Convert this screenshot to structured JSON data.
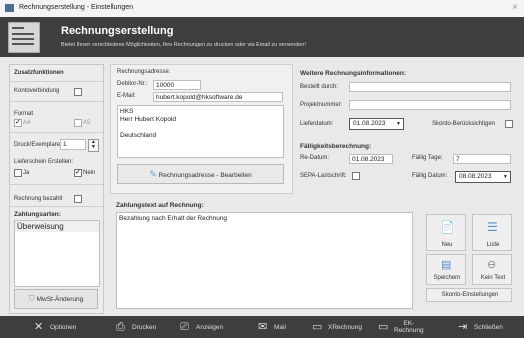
{
  "window": {
    "title": "Rechnungserstellung - Einstellungen",
    "close": "×"
  },
  "header": {
    "title": "Rechnungserstellung",
    "subtitle": "Bietet Ihnen verschiedene Möglichkeiten, Ihre Rechnungen zu drucken oder via Email zu versenden!"
  },
  "sidebar": {
    "zusatz_title": "Zusatzfunktionen",
    "kontoverbindung": "Kontoverbindung",
    "format_label": "Format",
    "format_a4": "A4",
    "format_a5": "A5",
    "druck_label": "Druck/Exemplare",
    "druck_value": "1",
    "lieferschein_label": "Lieferschein Erstellen:",
    "ja": "Ja",
    "nein": "Nein",
    "rechnung_bezahlt": "Rechnung bezahlt",
    "zahlungsarten_title": "Zahlungsarten:",
    "zahlungsart_item": "Überweisung",
    "mwst_button": "MwSt-Änderung"
  },
  "address": {
    "title": "Rechnungsadresse:",
    "debitor_label": "Debitor-Nr.:",
    "debitor_value": "10000",
    "email_label": "E-Mail:",
    "email_value": "hubert.kopold@hksoftware.de",
    "lines": [
      "HKS",
      "Herr Hubert Kopold",
      "",
      "Deutschland"
    ],
    "edit_button": "Rechnungsadresse - Bearbeiten"
  },
  "info": {
    "title": "Weitere Rechnungsinformationen:",
    "bestellt_label": "Bestellt durch:",
    "bestellt_value": "",
    "projekt_label": "Projektnummer:",
    "projekt_value": "",
    "lieferdatum_label": "Lieferdatum:",
    "lieferdatum_value": "01.08.2023",
    "skonto_label": "Skonto-Berücksichtigen"
  },
  "faellig": {
    "title": "Fälligkeitsberechnung:",
    "redatum_label": "Re-Datum:",
    "redatum_value": "01.08.2023",
    "tage_label": "Fällig Tage:",
    "tage_value": "7",
    "sepa_label": "SEPA-Lastschrift:",
    "faelligdatum_label": "Fällig Datum:",
    "faelligdatum_value": "08.08.2023"
  },
  "zahlungstext": {
    "title": "Zahlungstext auf Rechnung:",
    "value": "Bezahlung nach Erhalt der Rechnung"
  },
  "actions": {
    "neu": "Neu",
    "liste": "Liste",
    "speichern": "Speichern",
    "kein_text": "Kein Text",
    "skonto": "Skonto-Einstellungen"
  },
  "toolbar": {
    "optionen": "Optionen",
    "drucken": "Drucken",
    "anzeigen": "Anzeigen",
    "mail": "Mail",
    "xrechnung": "XRechnung",
    "ek_rechnung_1": "EK-",
    "ek_rechnung_2": "Rechnung",
    "schliessen": "Schließen"
  },
  "colors": {
    "header_bg": "#3e3e3e",
    "accent": "#4a6f95"
  }
}
